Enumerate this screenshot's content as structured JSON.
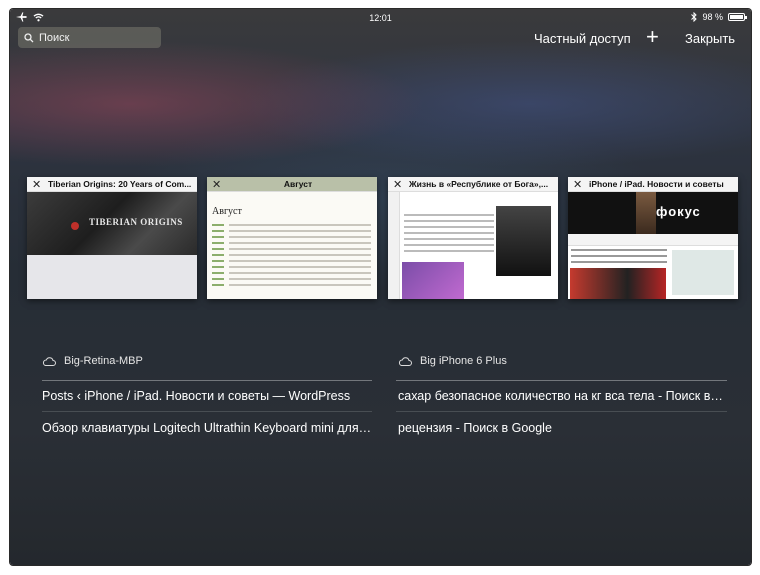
{
  "status": {
    "time": "12:01",
    "battery_text": "98 %",
    "battery_level": 0.98
  },
  "toolbar": {
    "search_placeholder": "Поиск",
    "private_label": "Частный доступ",
    "plus_label": "+",
    "close_label": "Закрыть"
  },
  "tabs": [
    {
      "title": "Tiberian Origins: 20 Years of Com...",
      "preview_text": "TIBERIAN ORIGINS"
    },
    {
      "title": "Август",
      "preview_text": "Август"
    },
    {
      "title": "Жизнь в «Республике от Бога»,..."
    },
    {
      "title": "iPhone / iPad. Новости и советы",
      "preview_text": "фокус"
    }
  ],
  "icloud": [
    {
      "device": "Big-Retina-MBP",
      "links": [
        "Posts ‹ iPhone / iPad. Новости и советы — WordPress",
        "Обзор клавиатуры Logitech Ultrathin Keyboard mini для i..."
      ]
    },
    {
      "device": "Big iPhone 6 Plus",
      "links": [
        "сахар безопасное количество на кг вса тела - Поиск в G...",
        "рецензия - Поиск в Google"
      ]
    }
  ],
  "icons": [
    "airplane-icon",
    "wifi-icon",
    "bluetooth-icon",
    "battery-icon",
    "search-icon",
    "close-icon",
    "cloud-icon"
  ]
}
